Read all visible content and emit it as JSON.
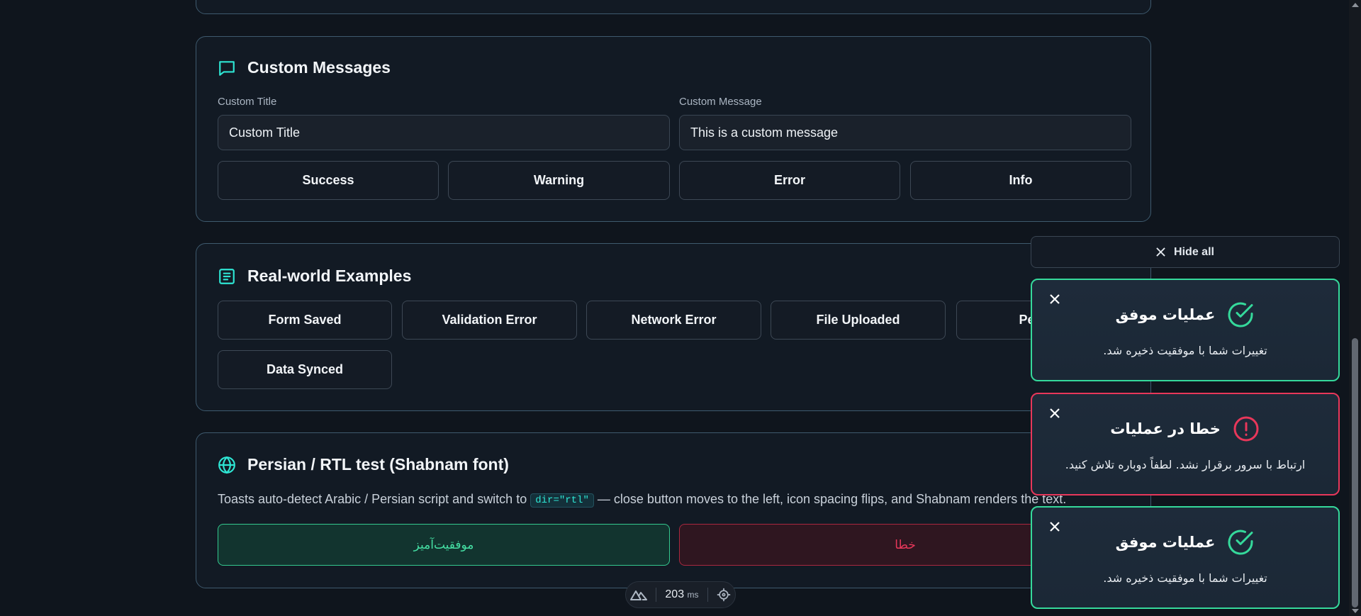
{
  "custom_messages": {
    "title": "Custom Messages",
    "title_label": "Custom Title",
    "title_value": "Custom Title",
    "message_label": "Custom Message",
    "message_value": "This is a custom message",
    "buttons": [
      "Success",
      "Warning",
      "Error",
      "Info"
    ]
  },
  "real_world": {
    "title": "Real-world Examples",
    "buttons": [
      "Form Saved",
      "Validation Error",
      "Network Error",
      "File Uploaded",
      "Permiss",
      "Data Synced"
    ]
  },
  "rtl_test": {
    "title": "Persian / RTL test (Shabnam font)",
    "desc_before": "Toasts auto-detect Arabic / Persian script and switch to",
    "code": "dir=\"rtl\"",
    "desc_after": "— close button moves to the left, icon spacing flips, and Shabnam renders the text.",
    "success_button": "موفقیت‌آمیز",
    "error_button": "خطا"
  },
  "perf": {
    "value": "203",
    "unit": "ms"
  },
  "toasts": {
    "hide_all": "Hide all",
    "items": [
      {
        "type": "success",
        "title": "عملیات موفق",
        "message": "تغییرات شما با موفقیت ذخیره شد."
      },
      {
        "type": "error",
        "title": "خطا در عملیات",
        "message": "ارتباط با سرور برقرار نشد. لطفاً دوباره تلاش کنید."
      },
      {
        "type": "success",
        "title": "عملیات موفق",
        "message": "تغییرات شما با موفقیت ذخیره شد."
      }
    ]
  },
  "colors": {
    "accent": "#2ee6d4",
    "success": "#35d99b",
    "error": "#e8375a",
    "background": "#0f151d"
  }
}
